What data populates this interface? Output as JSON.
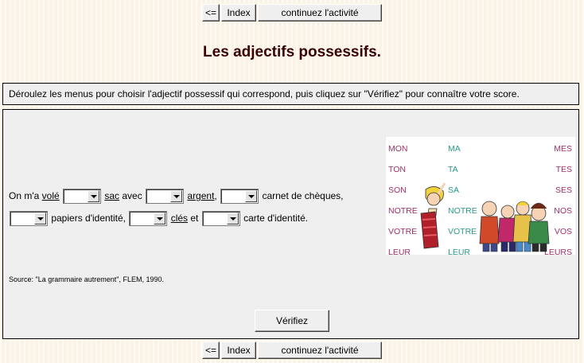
{
  "nav": {
    "back_label": "<=",
    "index_label": "Index",
    "continue_label": "continuez l'activité"
  },
  "title": "Les adjectifs possessifs.",
  "instructions": "Déroulez les menus pour choisir l'adjectif possessif qui correspond, puis cliquez sur \"Vérifiez\" pour connaître votre score.",
  "exercise": {
    "line1": {
      "t1": "On m'a ",
      "u1": "volé",
      "t2": "sac",
      "t3": " avec ",
      "t4": "argent",
      "t5": ",",
      "t6": " carnet de chèques,"
    },
    "line2": {
      "t1": " papiers d'identité, ",
      "u1": "clés",
      "t2": " et ",
      "t3": " carte d'identité."
    },
    "selects": [
      "",
      "",
      "",
      "",
      "",
      ""
    ]
  },
  "source": "Source: \"La grammaire autrement\", FLEM, 1990.",
  "verify_label": "Vérifiez",
  "illustration": {
    "col1": [
      "MON",
      "TON",
      "SON",
      "NOTRE",
      "VOTRE",
      "LEUR"
    ],
    "col2": [
      "MA",
      "TA",
      "SA",
      "NOTRE",
      "VOTRE",
      "LEUR"
    ],
    "col3": [
      "MES",
      "TES",
      "SES",
      "NOS",
      "VOS",
      "LEURS"
    ],
    "colors": {
      "col1": "#a0306a",
      "col2": "#2a9a8a",
      "col3": "#a0306a"
    }
  }
}
